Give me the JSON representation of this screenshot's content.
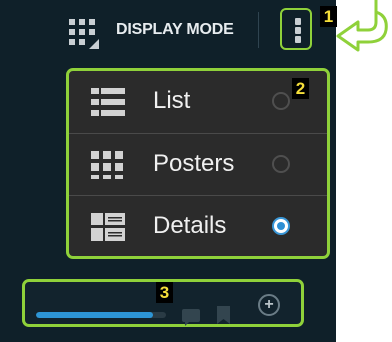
{
  "header": {
    "display_mode_label": "DISPLAY MODE",
    "display_mode_icon": "grid-view-icon",
    "overflow_icon": "vertical-dots-icon"
  },
  "callouts": [
    "1",
    "2",
    "3"
  ],
  "menu": {
    "items": [
      {
        "label": "List",
        "icon": "list-view-icon",
        "selected": false
      },
      {
        "label": "Posters",
        "icon": "posters-grid-icon",
        "selected": false
      },
      {
        "label": "Details",
        "icon": "details-view-icon",
        "selected": true
      }
    ]
  },
  "bottom_bar": {
    "progress_fraction": 0.9,
    "icons": [
      "comment-icon",
      "bookmark-icon",
      "add-circle-icon"
    ]
  },
  "colors": {
    "background": "#0f2029",
    "highlight": "#8fd13a",
    "accent": "#2e8fd4",
    "callout_text": "#f6df3a"
  }
}
